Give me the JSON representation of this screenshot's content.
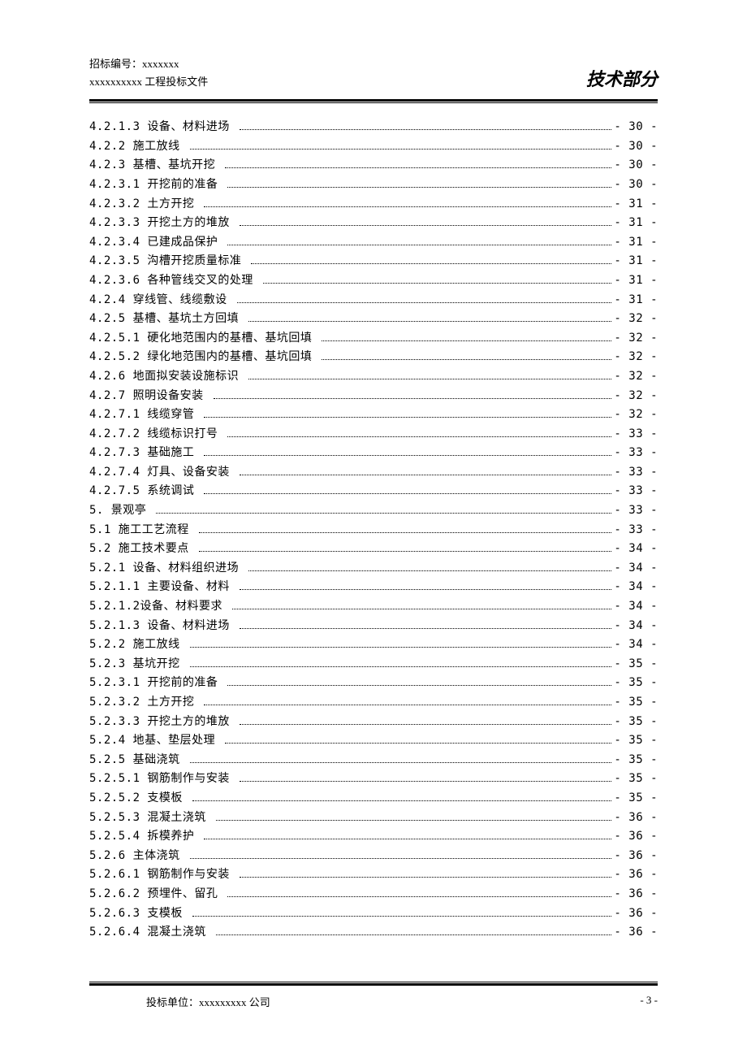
{
  "header": {
    "line1": "招标编号：xxxxxxx",
    "line2": "xxxxxxxxxx 工程投标文件",
    "right": "技术部分"
  },
  "toc": [
    {
      "num": "4.2.1.3",
      "title": "设备、材料进场",
      "page": "- 30 -"
    },
    {
      "num": "4.2.2",
      "title": "施工放线",
      "page": "- 30 -"
    },
    {
      "num": "4.2.3",
      "title": "基槽、基坑开挖",
      "page": "- 30 -"
    },
    {
      "num": "4.2.3.1",
      "title": "开挖前的准备",
      "page": "- 30 -"
    },
    {
      "num": "4.2.3.2",
      "title": "土方开挖",
      "page": "- 31 -"
    },
    {
      "num": "4.2.3.3",
      "title": "开挖土方的堆放",
      "page": "- 31 -"
    },
    {
      "num": "4.2.3.4",
      "title": "已建成品保护",
      "page": "- 31 -"
    },
    {
      "num": "4.2.3.5",
      "title": "沟槽开挖质量标准",
      "page": "- 31 -"
    },
    {
      "num": "4.2.3.6",
      "title": "各种管线交叉的处理",
      "page": "- 31 -"
    },
    {
      "num": "4.2.4",
      "title": "穿线管、线缆敷设",
      "page": "- 31 -"
    },
    {
      "num": "4.2.5",
      "title": "基槽、基坑土方回填",
      "page": "- 32 -"
    },
    {
      "num": "4.2.5.1",
      "title": "硬化地范围内的基槽、基坑回填",
      "page": "- 32 -"
    },
    {
      "num": "4.2.5.2",
      "title": "绿化地范围内的基槽、基坑回填",
      "page": "- 32 -"
    },
    {
      "num": "4.2.6",
      "title": "地面拟安装设施标识",
      "page": "- 32 -"
    },
    {
      "num": "4.2.7",
      "title": "照明设备安装",
      "page": "- 32 -"
    },
    {
      "num": "4.2.7.1",
      "title": "线缆穿管",
      "page": "- 32 -"
    },
    {
      "num": "4.2.7.2",
      "title": "线缆标识打号",
      "page": "- 33 -"
    },
    {
      "num": "4.2.7.3",
      "title": "基础施工",
      "page": "- 33 -"
    },
    {
      "num": "4.2.7.4",
      "title": "灯具、设备安装",
      "page": "- 33 -"
    },
    {
      "num": "4.2.7.5",
      "title": "系统调试",
      "page": "- 33 -"
    },
    {
      "num": "5.",
      "title": "景观亭",
      "page": "- 33 -"
    },
    {
      "num": "5.1",
      "title": "施工工艺流程",
      "page": "- 33 -"
    },
    {
      "num": "5.2",
      "title": "施工技术要点",
      "page": "- 34 -"
    },
    {
      "num": "5.2.1",
      "title": "设备、材料组织进场",
      "page": "- 34 -"
    },
    {
      "num": "5.2.1.1",
      "title": "主要设备、材料",
      "page": "- 34 -"
    },
    {
      "num": "5.2.1.2",
      "title": "设备、材料要求",
      "page": "- 34 -",
      "tight": true
    },
    {
      "num": "5.2.1.3",
      "title": "设备、材料进场",
      "page": "- 34 -"
    },
    {
      "num": "5.2.2",
      "title": "施工放线",
      "page": "- 34 -"
    },
    {
      "num": "5.2.3",
      "title": "基坑开挖",
      "page": "- 35 -"
    },
    {
      "num": "5.2.3.1",
      "title": "开挖前的准备",
      "page": "- 35 -"
    },
    {
      "num": "5.2.3.2",
      "title": "土方开挖",
      "page": "- 35 -"
    },
    {
      "num": "5.2.3.3",
      "title": "开挖土方的堆放",
      "page": "- 35 -"
    },
    {
      "num": "5.2.4",
      "title": "地基、垫层处理",
      "page": "- 35 -"
    },
    {
      "num": "5.2.5",
      "title": "基础浇筑",
      "page": "- 35 -"
    },
    {
      "num": "5.2.5.1",
      "title": "钢筋制作与安装",
      "page": "- 35 -"
    },
    {
      "num": "5.2.5.2",
      "title": "支模板",
      "page": "- 35 -"
    },
    {
      "num": "5.2.5.3",
      "title": "混凝土浇筑",
      "page": "- 36 -"
    },
    {
      "num": "5.2.5.4",
      "title": "拆模养护",
      "page": "- 36 -"
    },
    {
      "num": "5.2.6",
      "title": "主体浇筑",
      "page": "- 36 -"
    },
    {
      "num": "5.2.6.1",
      "title": "钢筋制作与安装",
      "page": "- 36 -"
    },
    {
      "num": "5.2.6.2",
      "title": "预埋件、留孔",
      "page": "- 36 -"
    },
    {
      "num": "5.2.6.3",
      "title": "支模板",
      "page": "- 36 -"
    },
    {
      "num": "5.2.6.4",
      "title": "混凝土浇筑",
      "page": "- 36 -"
    }
  ],
  "footer": {
    "left": "投标单位：xxxxxxxxx 公司",
    "right": "- 3 -"
  }
}
